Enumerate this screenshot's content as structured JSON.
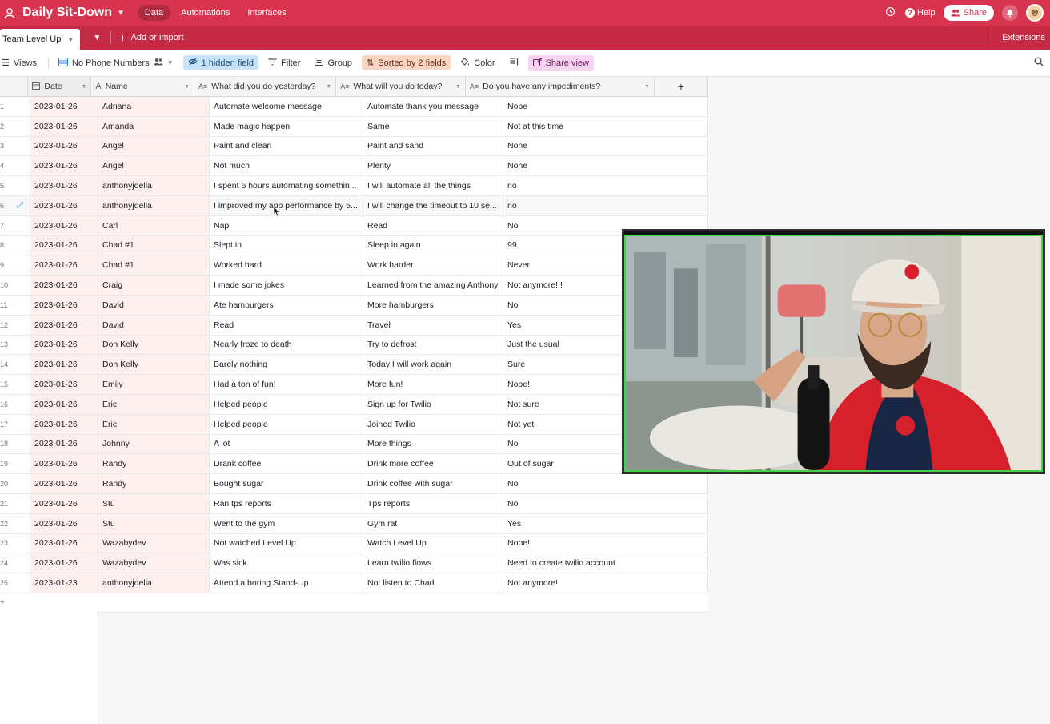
{
  "topbar": {
    "base_title": "Daily Sit-Down",
    "nav": [
      "Data",
      "Automations",
      "Interfaces"
    ],
    "help_label": "Help",
    "share_label": "Share"
  },
  "tabbar": {
    "active_table": "Team Level Up",
    "add_label": "Add or import",
    "extensions_label": "Extensions"
  },
  "toolbar": {
    "views_label": "Views",
    "view_name": "No Phone Numbers",
    "hidden_label": "1 hidden field",
    "filter_label": "Filter",
    "group_label": "Group",
    "sorted_label": "Sorted by 2 fields",
    "color_label": "Color",
    "share_view_label": "Share view"
  },
  "columns": {
    "date": "Date",
    "name": "Name",
    "yesterday": "What did you do yesterday?",
    "today": "What will you do today?",
    "impediments": "Do you have any impediments?"
  },
  "rows": [
    {
      "n": "1",
      "date": "2023-01-26",
      "name": "Adriana",
      "y": "Automate welcome message",
      "t": "Automate thank you message",
      "i": "Nope"
    },
    {
      "n": "2",
      "date": "2023-01-26",
      "name": "Amanda",
      "y": "Made magic happen",
      "t": "Same",
      "i": "Not at this time"
    },
    {
      "n": "3",
      "date": "2023-01-26",
      "name": "Angel",
      "y": "Paint and clean",
      "t": "Paint and sand",
      "i": "None"
    },
    {
      "n": "4",
      "date": "2023-01-26",
      "name": "Angel",
      "y": "Not much",
      "t": "Plenty",
      "i": "None"
    },
    {
      "n": "5",
      "date": "2023-01-26",
      "name": "anthonyjdella",
      "y": "I spent 6 hours automating somethin...",
      "t": "I will automate all the things",
      "i": "no"
    },
    {
      "n": "6",
      "date": "2023-01-26",
      "name": "anthonyjdella",
      "y": "I improved my app performance by 5...",
      "t": "I will change the timeout to 10 se...",
      "i": "no"
    },
    {
      "n": "7",
      "date": "2023-01-26",
      "name": "Carl",
      "y": "Nap",
      "t": "Read",
      "i": "No"
    },
    {
      "n": "8",
      "date": "2023-01-26",
      "name": "Chad #1",
      "y": "Slept in",
      "t": "Sleep in again",
      "i": "99"
    },
    {
      "n": "9",
      "date": "2023-01-26",
      "name": "Chad #1",
      "y": "Worked hard",
      "t": "Work harder",
      "i": "Never"
    },
    {
      "n": "10",
      "date": "2023-01-26",
      "name": "Craig",
      "y": "I made some jokes",
      "t": "Learned from the amazing Anthony",
      "i": "Not anymore!!!"
    },
    {
      "n": "11",
      "date": "2023-01-26",
      "name": "David",
      "y": "Ate hamburgers",
      "t": "More hamburgers",
      "i": "No"
    },
    {
      "n": "12",
      "date": "2023-01-26",
      "name": "David",
      "y": "Read",
      "t": "Travel",
      "i": "Yes"
    },
    {
      "n": "13",
      "date": "2023-01-26",
      "name": "Don Kelly",
      "y": "Nearly froze to death",
      "t": "Try to defrost",
      "i": "Just the usual"
    },
    {
      "n": "14",
      "date": "2023-01-26",
      "name": "Don Kelly",
      "y": "Barely nothing",
      "t": "Today I will work again",
      "i": "Sure"
    },
    {
      "n": "15",
      "date": "2023-01-26",
      "name": "Emily",
      "y": "Had a ton of fun!",
      "t": "More fun!",
      "i": "Nope!"
    },
    {
      "n": "16",
      "date": "2023-01-26",
      "name": "Eric",
      "y": "Helped people",
      "t": "Sign up for Twilio",
      "i": "Not sure"
    },
    {
      "n": "17",
      "date": "2023-01-26",
      "name": "Eric",
      "y": "Helped people",
      "t": "Joined Twilio",
      "i": "Not yet"
    },
    {
      "n": "18",
      "date": "2023-01-26",
      "name": "Johnny",
      "y": "A lot",
      "t": "More things",
      "i": "No"
    },
    {
      "n": "19",
      "date": "2023-01-26",
      "name": "Randy",
      "y": "Drank coffee",
      "t": "Drink more coffee",
      "i": "Out of sugar"
    },
    {
      "n": "20",
      "date": "2023-01-26",
      "name": "Randy",
      "y": "Bought sugar",
      "t": "Drink coffee with sugar",
      "i": "No"
    },
    {
      "n": "21",
      "date": "2023-01-26",
      "name": "Stu",
      "y": "Ran tps reports",
      "t": "Tps reports",
      "i": "No"
    },
    {
      "n": "22",
      "date": "2023-01-26",
      "name": "Stu",
      "y": "Went to the gym",
      "t": "Gym rat",
      "i": "Yes"
    },
    {
      "n": "23",
      "date": "2023-01-26",
      "name": "Wazabydev",
      "y": "Not watched Level Up",
      "t": "Watch Level Up",
      "i": "Nope!"
    },
    {
      "n": "24",
      "date": "2023-01-26",
      "name": "Wazabydev",
      "y": "Was sick",
      "t": "Learn twilio flows",
      "i": "Need to create twilio account"
    },
    {
      "n": "25",
      "date": "2023-01-23",
      "name": "anthonyjdella",
      "y": "Attend a boring Stand-Up",
      "t": "Not listen to Chad",
      "i": "Not anymore!"
    }
  ],
  "colors": {
    "topbar": "#d9344f",
    "tabbar": "#c52b45",
    "hidden_chip": "#c8e3f7",
    "sorted_chip": "#f7d6c6",
    "share_view_chip": "#f5d4f0",
    "primary_cell_tint": "#fdf0ee",
    "video_border": "#3fd24a"
  }
}
